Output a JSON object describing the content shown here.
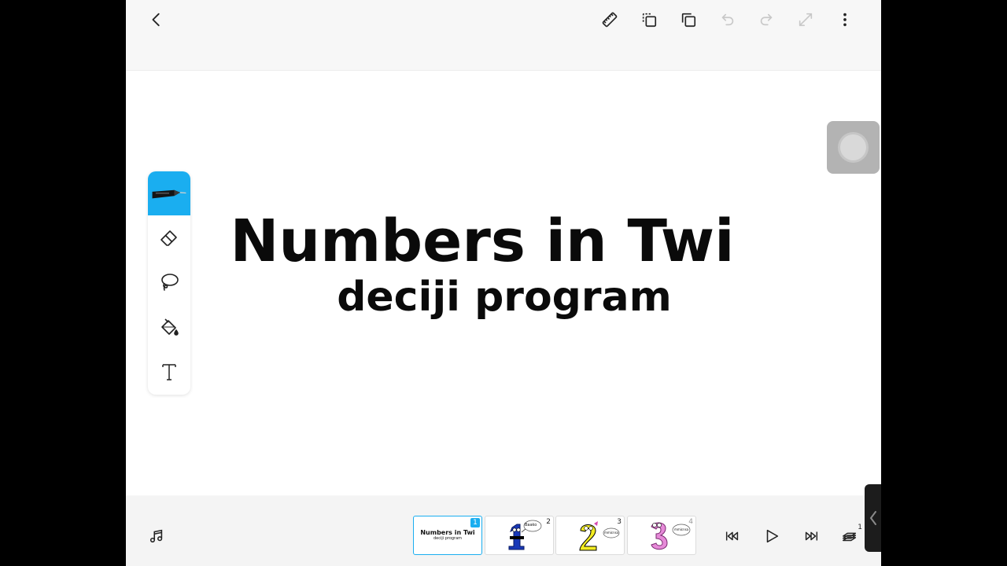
{
  "colors": {
    "accent": "#1aaef0",
    "toolbar_bg": "#f7f7f7",
    "canvas_bg": "#ffffff"
  },
  "canvas": {
    "title": "Numbers in Twi",
    "subtitle": "deciji program"
  },
  "top_toolbar": {
    "icons": [
      "back-chevron-icon",
      "ruler-icon",
      "copy-frame-icon",
      "duplicate-icon",
      "undo-icon",
      "redo-icon",
      "expand-icon",
      "more-vertical-icon"
    ]
  },
  "tools": {
    "active": "pen",
    "items": [
      "pen",
      "eraser",
      "lasso",
      "fill-bucket",
      "text"
    ]
  },
  "frames": [
    {
      "number": "1",
      "title": "Numbers in Twi",
      "subtitle": "deciji program"
    },
    {
      "number": "2",
      "bubble": "Baako"
    },
    {
      "number": "3",
      "bubble": "mmiɛnsa"
    },
    {
      "number": "4",
      "bubble": "mmiɛnsa"
    }
  ],
  "frames_badge": "1",
  "bottom_toolbar": {
    "icons": [
      "music-note-icon",
      "skip-to-start-icon",
      "play-icon",
      "skip-to-end-icon",
      "layers-icon"
    ]
  }
}
